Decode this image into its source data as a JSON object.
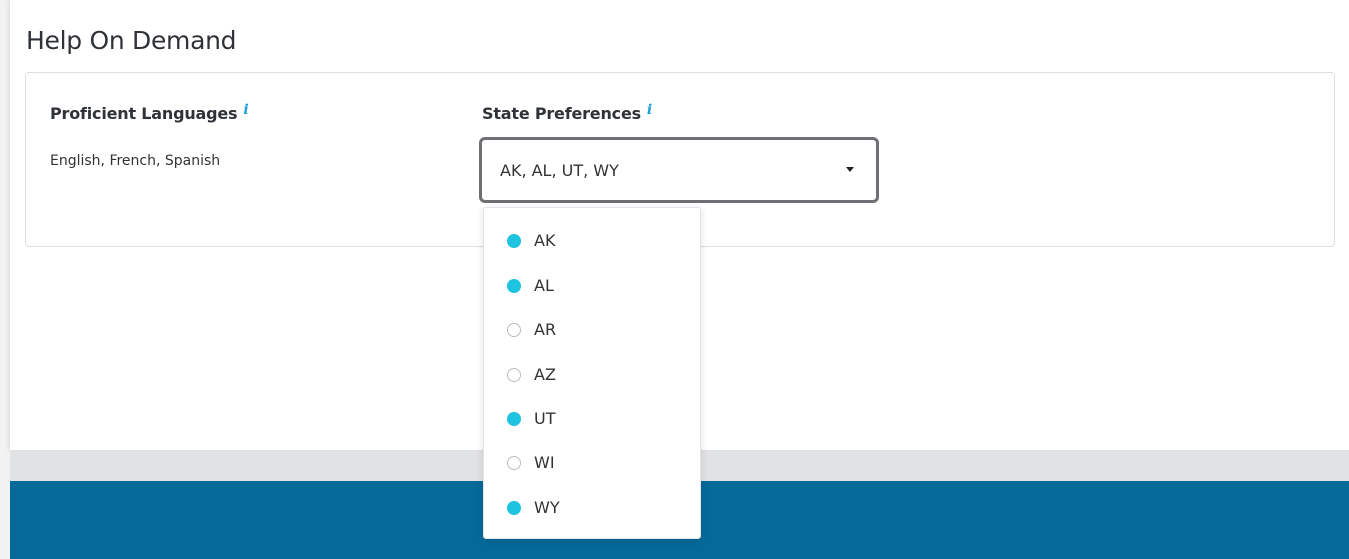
{
  "page_title": "Help On Demand",
  "languages": {
    "label": "Proficient Languages",
    "info": "i",
    "value": "English, French, Spanish"
  },
  "states": {
    "label": "State Preferences",
    "info": "i",
    "selected_value": "AK, AL, UT, WY",
    "options": [
      {
        "label": "AK",
        "selected": true
      },
      {
        "label": "AL",
        "selected": true
      },
      {
        "label": "AR",
        "selected": false
      },
      {
        "label": "AZ",
        "selected": false
      },
      {
        "label": "UT",
        "selected": true
      },
      {
        "label": "WI",
        "selected": false
      },
      {
        "label": "WY",
        "selected": true
      }
    ]
  },
  "colors": {
    "accent": "#1ec3e0",
    "info_icon": "#1a9fd9",
    "footer_blue": "#066a99",
    "footer_gray": "#e1e2e3"
  }
}
